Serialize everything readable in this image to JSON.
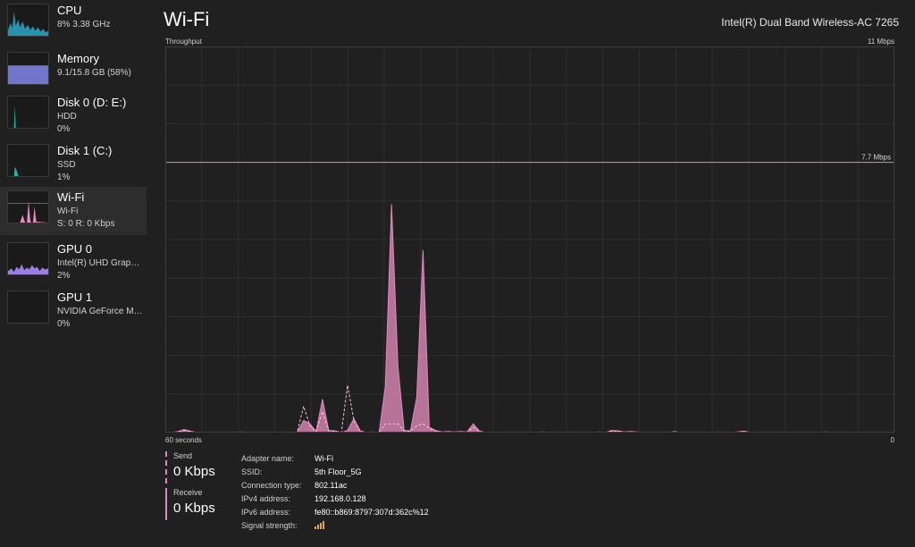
{
  "sidebar": {
    "items": [
      {
        "title": "CPU",
        "line1": "8%  3.38 GHz",
        "line2": "",
        "color": "#2aa7c9",
        "icon": "cpu-graph-icon"
      },
      {
        "title": "Memory",
        "line1": "9.1/15.8 GB (58%)",
        "line2": "",
        "color": "#7b7fe0",
        "icon": "memory-graph-icon"
      },
      {
        "title": "Disk 0 (D: E:)",
        "line1": "HDD",
        "line2": "0%",
        "color": "#2bb3a0",
        "icon": "disk-graph-icon"
      },
      {
        "title": "Disk 1 (C:)",
        "line1": "SSD",
        "line2": "1%",
        "color": "#2bb3a0",
        "icon": "disk-graph-icon"
      },
      {
        "title": "Wi-Fi",
        "line1": "Wi-Fi",
        "line2": "S: 0  R: 0 Kbps",
        "color": "#e08ab8",
        "icon": "wifi-graph-icon"
      },
      {
        "title": "GPU 0",
        "line1": "Intel(R) UHD Graphic...",
        "line2": "2%",
        "color": "#9a7fe0",
        "icon": "gpu-graph-icon"
      },
      {
        "title": "GPU 1",
        "line1": "NVIDIA GeForce MX...",
        "line2": "0%",
        "color": "#9a7fe0",
        "icon": "gpu-graph-icon"
      }
    ]
  },
  "header": {
    "title": "Wi-Fi",
    "adapter": "Intel(R) Dual Band Wireless-AC 7265"
  },
  "graph": {
    "top_left_label": "Throughput",
    "top_right_label": "11 Mbps",
    "ref_line_label": "7.7 Mbps",
    "bottom_left_label": "60 seconds",
    "bottom_right_label": "0",
    "accent_color": "#e08ab8",
    "max_mbps": 11,
    "ref_mbps": 7.7,
    "receive_mbps": [
      0,
      0,
      0.03,
      0.09,
      0.04,
      0,
      0,
      0,
      0,
      0,
      0,
      0,
      0.02,
      0,
      0,
      0,
      0,
      0,
      0,
      0,
      0,
      0.02,
      0.35,
      0.25,
      0.03,
      0.95,
      0.06,
      0.05,
      0,
      0.07,
      0.4,
      0.05,
      0,
      0.02,
      0,
      1.3,
      6.5,
      1.9,
      0.06,
      0.05,
      1.0,
      5.2,
      0.15,
      0.06,
      0.02,
      0.03,
      0.02,
      0.03,
      0.02,
      0.25,
      0.04,
      0,
      0,
      0,
      0,
      0,
      0,
      0,
      0,
      0,
      0.02,
      0,
      0,
      0,
      0,
      0,
      0,
      0,
      0,
      0.02,
      0,
      0.06,
      0.05,
      0.02,
      0.03,
      0.02,
      0.01,
      0,
      0,
      0,
      0,
      0.03,
      0,
      0,
      0,
      0,
      0,
      0.01,
      0,
      0,
      0,
      0.02,
      0.04,
      0.01,
      0.01,
      0,
      0,
      0,
      0,
      0,
      0,
      0,
      0,
      0,
      0,
      0.02,
      0.01,
      0,
      0,
      0,
      0,
      0,
      0,
      0,
      0,
      0,
      0
    ],
    "send_mbps": [
      0,
      0,
      0.02,
      0.06,
      0.03,
      0,
      0,
      0,
      0,
      0,
      0,
      0,
      0.01,
      0,
      0,
      0,
      0,
      0,
      0,
      0,
      0,
      0.01,
      0.75,
      0.2,
      0.03,
      0.6,
      0.05,
      0.04,
      0,
      1.35,
      0.35,
      0.04,
      0,
      0.01,
      0,
      0.25,
      0.25,
      0.25,
      0.05,
      0.04,
      0.2,
      0.25,
      0.12,
      0.05,
      0.01,
      0.02,
      0.01,
      0.02,
      0.01,
      0.15,
      0.03,
      0,
      0,
      0,
      0,
      0,
      0,
      0,
      0,
      0,
      0.01,
      0,
      0,
      0,
      0,
      0,
      0,
      0,
      0,
      0.01,
      0,
      0.04,
      0.04,
      0.01,
      0.02,
      0.01,
      0,
      0,
      0,
      0,
      0,
      0.02,
      0,
      0,
      0,
      0,
      0,
      0,
      0,
      0,
      0,
      0.01,
      0.03,
      0,
      0,
      0,
      0,
      0,
      0,
      0,
      0,
      0,
      0,
      0,
      0,
      0.01,
      0,
      0,
      0,
      0,
      0,
      0,
      0,
      0,
      0,
      0,
      0
    ]
  },
  "stats": {
    "send_label": "Send",
    "send_value": "0 Kbps",
    "receive_label": "Receive",
    "receive_value": "0 Kbps"
  },
  "details": [
    {
      "label": "Adapter name:",
      "value": "Wi-Fi"
    },
    {
      "label": "SSID:",
      "value": "5th Floor_5G"
    },
    {
      "label": "Connection type:",
      "value": "802.11ac"
    },
    {
      "label": "IPv4 address:",
      "value": "192.168.0.128"
    },
    {
      "label": "IPv6 address:",
      "value": "fe80::b869:8797:307d:362c%12"
    },
    {
      "label": "Signal strength:",
      "value": ""
    }
  ],
  "signal": {
    "bars": 4,
    "icon": "signal-strength-icon",
    "color": "#e8a34b"
  }
}
